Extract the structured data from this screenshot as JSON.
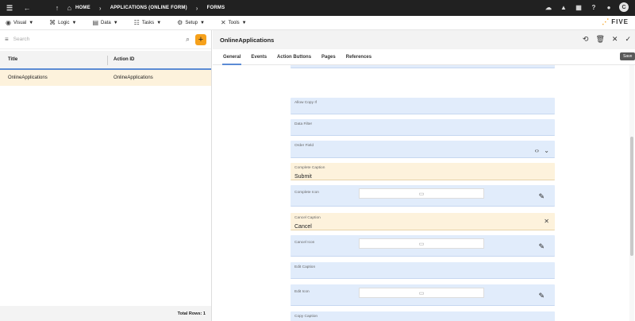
{
  "topbar": {
    "menu_icon": "hamburger-icon",
    "back_icon": "arrow-left-icon",
    "up_icon": "arrow-up-icon",
    "home_icon": "home-icon",
    "crumbs": [
      "HOME",
      "APPLICATIONS (ONLINE FORM)",
      "FORMS"
    ],
    "avatar_initial": "C"
  },
  "menubar": {
    "items": [
      {
        "label": "Visual",
        "icon": "eye-icon"
      },
      {
        "label": "Logic",
        "icon": "logic-icon"
      },
      {
        "label": "Data",
        "icon": "table-icon"
      },
      {
        "label": "Tasks",
        "icon": "tasks-icon"
      },
      {
        "label": "Setup",
        "icon": "gear-icon"
      },
      {
        "label": "Tools",
        "icon": "tools-icon"
      }
    ],
    "logo": "FIVE"
  },
  "left": {
    "search_placeholder": "Search",
    "columns": [
      "Title",
      "Action ID"
    ],
    "rows": [
      {
        "title": "OnlineApplications",
        "action_id": "OnlineApplications"
      }
    ],
    "footer": "Total Rows: 1"
  },
  "right": {
    "title": "OnlineApplications",
    "tabs": [
      "General",
      "Events",
      "Action Buttons",
      "Pages",
      "References"
    ],
    "active_tab": "General",
    "tooltip": "Save",
    "fields": [
      {
        "label": "Allow Copy If",
        "value": ""
      },
      {
        "label": "Data Filter",
        "value": ""
      },
      {
        "label": "Order Field",
        "value": ""
      },
      {
        "label": "Complete Caption",
        "value": "Submit"
      },
      {
        "label": "Complete Icon",
        "value": ""
      },
      {
        "label": "Cancel Caption",
        "value": "Cancel"
      },
      {
        "label": "Cancel Icon",
        "value": ""
      },
      {
        "label": "Edit Caption",
        "value": ""
      },
      {
        "label": "Edit Icon",
        "value": ""
      },
      {
        "label": "Copy Caption",
        "value": ""
      }
    ]
  }
}
